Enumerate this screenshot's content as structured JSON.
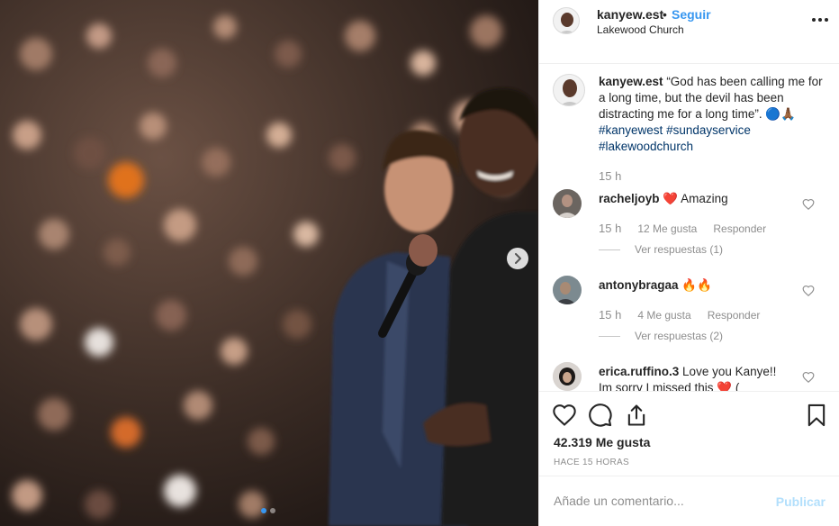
{
  "header": {
    "username": "kanyew.est",
    "separator": "•",
    "follow_label": "Seguir",
    "location": "Lakewood Church",
    "more_icon": "more-horizontal-icon"
  },
  "caption": {
    "username": "kanyew.est",
    "text": "“God has been calling me for a long time, but the devil has been distracting me for a long time”. 🔵🙏🏾",
    "hashtags": [
      "#kanyewest",
      "#sundayservice",
      "#lakewoodchurch"
    ],
    "time": "15 h"
  },
  "comments": [
    {
      "username": "racheljoyb",
      "text": "❤️ Amazing",
      "time": "15 h",
      "likes": "12 Me gusta",
      "reply": "Responder",
      "view_replies": "Ver respuestas (1)"
    },
    {
      "username": "antonybragaa",
      "text": "🔥🔥",
      "time": "15 h",
      "likes": "4 Me gusta",
      "reply": "Responder",
      "view_replies": "Ver respuestas (2)"
    },
    {
      "username": "erica.ruffino.3",
      "text": "Love you Kanye!!",
      "text_line2": "Im sorry I missed this ❤️ (",
      "time": "",
      "likes": "",
      "reply": "",
      "view_replies": ""
    }
  ],
  "actions": {
    "like_icon": "heart-outline-icon",
    "comment_icon": "comment-icon",
    "share_icon": "share-icon",
    "save_icon": "bookmark-icon",
    "likes_count": "42.319 Me gusta",
    "posted_ago": "HACE 15 HORAS"
  },
  "composer": {
    "placeholder": "Añade un comentario...",
    "publish_label": "Publicar"
  },
  "colors": {
    "accent": "#3897f0",
    "publish_disabled": "#b2dffc",
    "heart_red": "#ed4956"
  },
  "carousel": {
    "slides": 2,
    "active": 1
  }
}
